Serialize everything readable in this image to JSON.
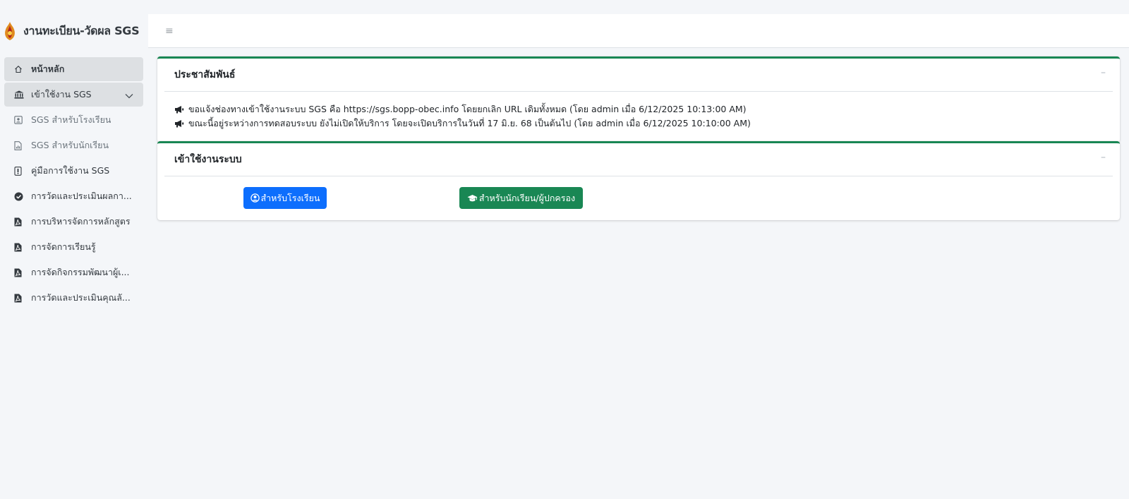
{
  "brand": {
    "title": "งานทะเบียน-วัดผล SGS",
    "logo_icon": "school-emblem-icon"
  },
  "topbar": {
    "menu_icon": "≡"
  },
  "sidebar": {
    "items": [
      {
        "label": "หน้าหลัก",
        "icon": "home-icon",
        "active": true
      },
      {
        "label": "เข้าใช้งาน SGS",
        "icon": "bank-icon",
        "active": true,
        "expanded": true
      },
      {
        "label": "SGS สำหรับโรงเรียน",
        "icon": "id-card-icon",
        "sub": true
      },
      {
        "label": "SGS สำหรับนักเรียน",
        "icon": "file-chart-icon",
        "sub": true
      },
      {
        "label": "คู่มือการใช้งาน SGS",
        "icon": "file-icon"
      },
      {
        "label": "การวัดและประเมินผลกา...",
        "icon": "check-badge-icon"
      },
      {
        "label": "การบริหารจัดการหลักสูตร",
        "icon": "pdf-icon"
      },
      {
        "label": "การจัดการเรียนรู้",
        "icon": "pdf-icon"
      },
      {
        "label": "การจัดกิจกรรมพัฒนาผู้เ...",
        "icon": "pdf-icon"
      },
      {
        "label": "การวัดและประเมินคุณลั...",
        "icon": "pdf-icon"
      }
    ]
  },
  "announcements": {
    "title": "ประชาสัมพันธ์",
    "items": [
      "ขอแจ้งช่องทางเข้าใช้งานระบบ SGS คือ https://sgs.bopp-obec.info โดยยกเลิก URL เดิมทั้งหมด (โดย admin เมื่อ 6/12/2025 10:13:00 AM)",
      "ขณะนี้อยู่ระหว่างการทดสอบระบบ ยังไม่เปิดให้บริการ โดยจะเปิดบริการในวันที่ 17 มิ.ย. 68 เป็นต้นไป (โดย admin เมื่อ 6/12/2025 10:10:00 AM)"
    ]
  },
  "login": {
    "title": "เข้าใช้งานระบบ",
    "school_button": "สำหรับโรงเรียน",
    "student_button": "สำหรับนักเรียน/ผู้ปกครอง"
  },
  "colors": {
    "accent_green": "#198754",
    "primary_blue": "#0d6efd",
    "active_bg": "#dde0e3"
  }
}
